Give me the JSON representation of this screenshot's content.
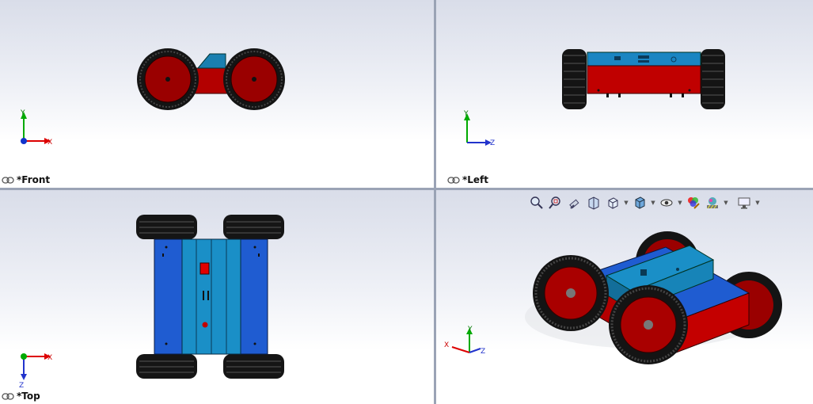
{
  "viewports": {
    "front": {
      "label": "*Front",
      "axes": {
        "vertical": "Y",
        "horizontal": "X"
      }
    },
    "left": {
      "label": "*Left",
      "axes": {
        "vertical": "Y",
        "horizontal": "Z"
      }
    },
    "top": {
      "label": "*Top",
      "axes": {
        "vertical": "Z",
        "horizontal": "X"
      }
    },
    "iso": {
      "axes": {
        "x": "X",
        "y": "Y",
        "z": "Z"
      }
    }
  },
  "toolbar": {
    "icons": [
      "zoom-to-fit-icon",
      "zoom-to-area-icon",
      "previous-view-icon",
      "section-view-icon",
      "view-orientation-icon",
      "display-style-icon",
      "hide-show-items-icon",
      "edit-appearance-icon",
      "apply-scene-icon",
      "view-settings-icon"
    ]
  },
  "colors": {
    "body_red": "#c00000",
    "panel_blue": "#1f5cd1",
    "panel_cyan": "#1a8fc7",
    "tire": "#151515",
    "hub_red": "#a90000",
    "viewport_divider": "#8e97ab"
  }
}
